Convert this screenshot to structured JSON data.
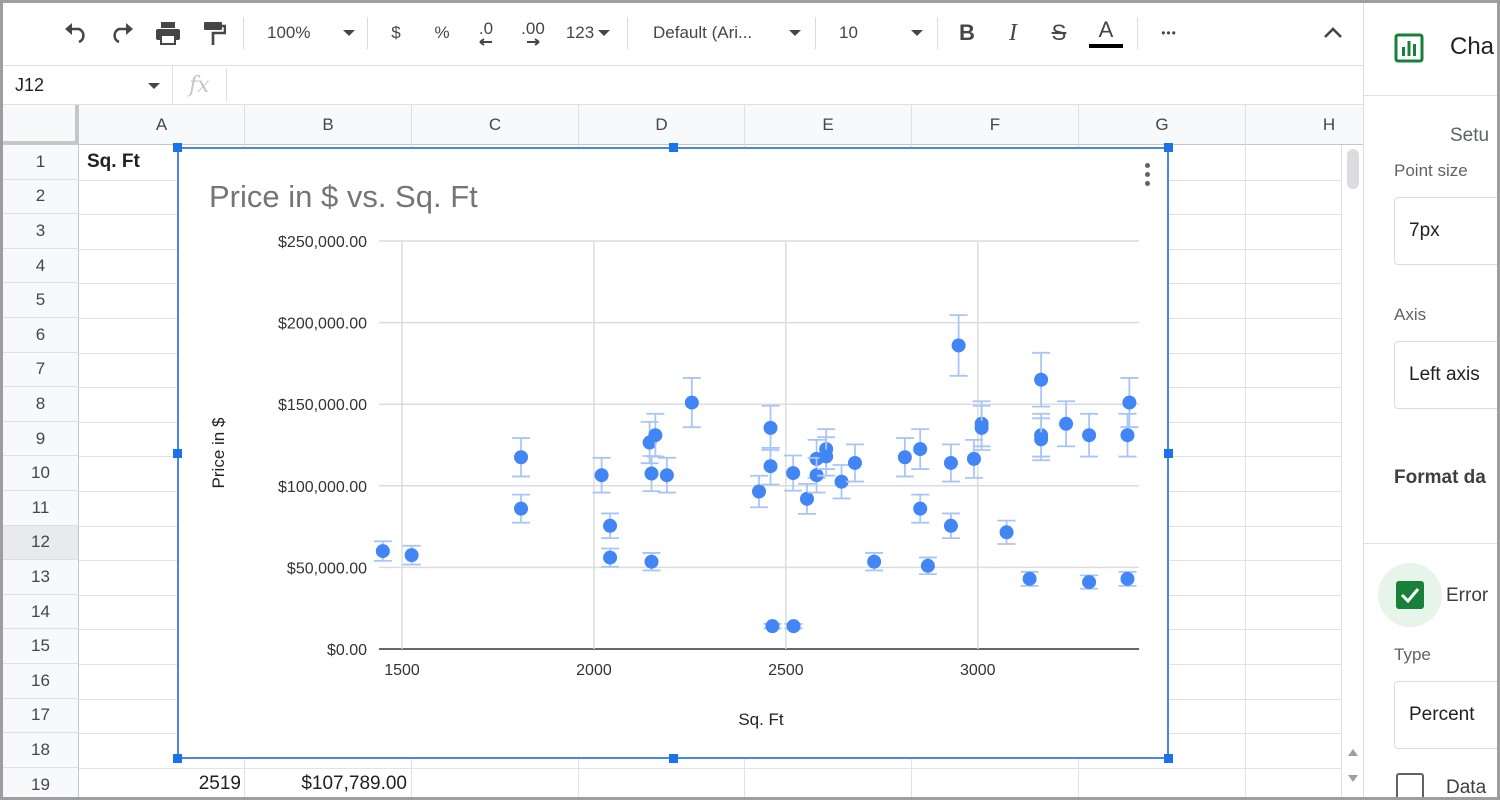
{
  "toolbar": {
    "zoom": "100%",
    "currency": "$",
    "percent": "%",
    "decrease_decimal": ".0",
    "increase_decimal": ".00",
    "more_formats": "123",
    "font_family": "Default (Ari...",
    "font_size": "10",
    "bold": "B",
    "italic": "I",
    "strikethrough": "S",
    "text_color": "A",
    "more": "•••"
  },
  "formula_bar": {
    "name_box": "J12",
    "fx": "fx",
    "value": ""
  },
  "sheet": {
    "columns": [
      "A",
      "B",
      "C",
      "D",
      "E",
      "F",
      "G",
      "H"
    ],
    "rows": [
      "1",
      "2",
      "3",
      "4",
      "5",
      "6",
      "7",
      "8",
      "9",
      "10",
      "11",
      "12",
      "13",
      "14",
      "15",
      "16",
      "17",
      "18",
      "19"
    ],
    "active_row": "12",
    "cell_a1": "Sq. Ft",
    "cell_a19": "2519",
    "cell_b19": "$107,789.00"
  },
  "chart_data": {
    "type": "scatter",
    "title": "Price in $ vs. Sq. Ft",
    "xlabel": "Sq. Ft",
    "ylabel": "Price in $",
    "xlim": [
      1440,
      3420
    ],
    "ylim": [
      0,
      250000
    ],
    "x_ticks": [
      1500,
      2000,
      2500,
      3000
    ],
    "y_ticks": [
      0,
      50000,
      100000,
      150000,
      200000,
      250000
    ],
    "y_tick_labels": [
      "$0.00",
      "$50,000.00",
      "$100,000.00",
      "$150,000.00",
      "$200,000.00",
      "$250,000.00"
    ],
    "error_bars": {
      "type": "Percent",
      "value": 10
    },
    "color": "#4285f4",
    "error_color": "#a9c5f7",
    "grid": true,
    "points": [
      {
        "x": 1450,
        "y": 60000
      },
      {
        "x": 1525,
        "y": 57500
      },
      {
        "x": 1810,
        "y": 117500
      },
      {
        "x": 1810,
        "y": 86000
      },
      {
        "x": 2020,
        "y": 106500
      },
      {
        "x": 2042,
        "y": 75500
      },
      {
        "x": 2042,
        "y": 56000
      },
      {
        "x": 2145,
        "y": 126500
      },
      {
        "x": 2160,
        "y": 131000
      },
      {
        "x": 2150,
        "y": 107500
      },
      {
        "x": 2150,
        "y": 53500
      },
      {
        "x": 2190,
        "y": 106500
      },
      {
        "x": 2255,
        "y": 151000
      },
      {
        "x": 2430,
        "y": 96500
      },
      {
        "x": 2460,
        "y": 135500
      },
      {
        "x": 2460,
        "y": 112000
      },
      {
        "x": 2465,
        "y": 14000
      },
      {
        "x": 2520,
        "y": 14000
      },
      {
        "x": 2519,
        "y": 107789
      },
      {
        "x": 2555,
        "y": 92000
      },
      {
        "x": 2580,
        "y": 116500
      },
      {
        "x": 2580,
        "y": 106500
      },
      {
        "x": 2605,
        "y": 122500
      },
      {
        "x": 2605,
        "y": 118000
      },
      {
        "x": 2645,
        "y": 102500
      },
      {
        "x": 2680,
        "y": 114000
      },
      {
        "x": 2730,
        "y": 53500
      },
      {
        "x": 2810,
        "y": 117500
      },
      {
        "x": 2850,
        "y": 122500
      },
      {
        "x": 2850,
        "y": 86000
      },
      {
        "x": 2870,
        "y": 51000
      },
      {
        "x": 2930,
        "y": 114000
      },
      {
        "x": 2930,
        "y": 75500
      },
      {
        "x": 2950,
        "y": 186000
      },
      {
        "x": 2990,
        "y": 116500
      },
      {
        "x": 3010,
        "y": 138000
      },
      {
        "x": 3010,
        "y": 135500
      },
      {
        "x": 3075,
        "y": 71500
      },
      {
        "x": 3135,
        "y": 43000
      },
      {
        "x": 3165,
        "y": 165000
      },
      {
        "x": 3165,
        "y": 131000
      },
      {
        "x": 3165,
        "y": 128500
      },
      {
        "x": 3230,
        "y": 138000
      },
      {
        "x": 3290,
        "y": 131000
      },
      {
        "x": 3290,
        "y": 41000
      },
      {
        "x": 3390,
        "y": 131000
      },
      {
        "x": 3395,
        "y": 151000
      },
      {
        "x": 3390,
        "y": 43000
      }
    ]
  },
  "panel": {
    "title": "Cha",
    "tab_setup": "Setu",
    "point_size_label": "Point size",
    "point_size_value": "7px",
    "axis_label": "Axis",
    "axis_value": "Left axis",
    "format_heading": "Format da",
    "error_bars_label": "Error",
    "type_label": "Type",
    "type_value": "Percent",
    "data_label": "Data",
    "accent": "#188038"
  }
}
